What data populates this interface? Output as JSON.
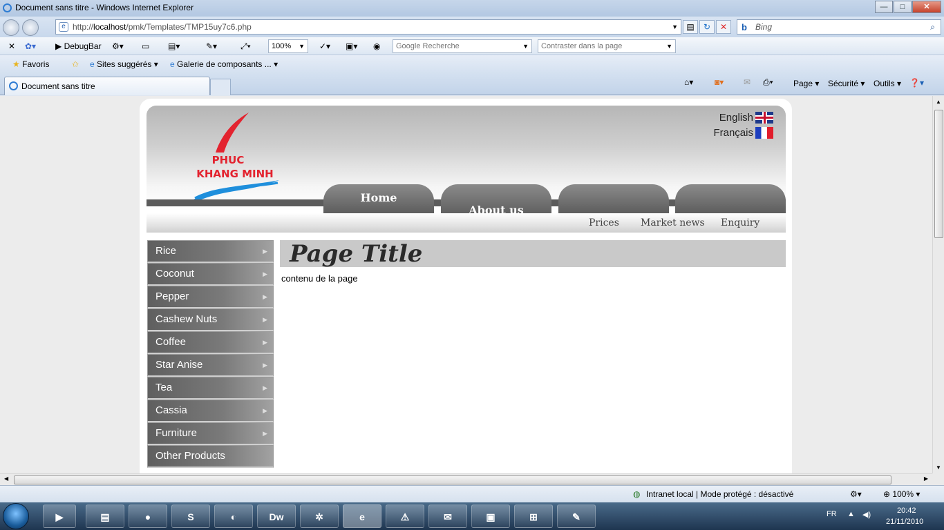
{
  "window": {
    "title": "Document sans titre - Windows Internet Explorer",
    "min": "—",
    "max": "□",
    "close": "✕"
  },
  "address": {
    "prefix": "http://",
    "host": "localhost",
    "path": "/pmk/Templates/TMP15uy7c6.php"
  },
  "search": {
    "placeholder": "Bing"
  },
  "toolbar": {
    "debugbar": "DebugBar",
    "zoom": "100%",
    "google_placeholder": "Google Recherche",
    "contrast_placeholder": "Contraster dans la page"
  },
  "favorites": {
    "label": "Favoris",
    "suggested": "Sites suggérés",
    "gallery": "Galerie de composants ..."
  },
  "tab": {
    "title": "Document sans titre"
  },
  "commands": {
    "page": "Page",
    "security": "Sécurité",
    "tools": "Outils"
  },
  "site": {
    "logo_line1": "PHUC",
    "logo_line2": "KHANG MINH",
    "lang_en": "English",
    "lang_fr": "Français",
    "nav": [
      "Home",
      "About us",
      "",
      ""
    ],
    "subnav": [
      "Prices",
      "Market news",
      "Enquiry"
    ],
    "menu": [
      "Rice",
      "Coconut",
      "Pepper",
      "Cashew Nuts",
      "Coffee",
      "Star Anise",
      "Tea",
      "Cassia",
      "Furniture",
      "Other Products"
    ],
    "page_title": "Page Title",
    "content": "contenu de la page"
  },
  "status": {
    "zone": "Intranet local | Mode protégé : désactivé",
    "zoom": "100%"
  },
  "taskbar": {
    "lang": "FR",
    "time": "20:42",
    "date": "21/11/2010"
  },
  "colors": {
    "logo_red": "#e3232f",
    "logo_blue": "#1f8fdc",
    "menu_gray": "#6b6b6b",
    "title_bg": "#c9c9c9"
  }
}
